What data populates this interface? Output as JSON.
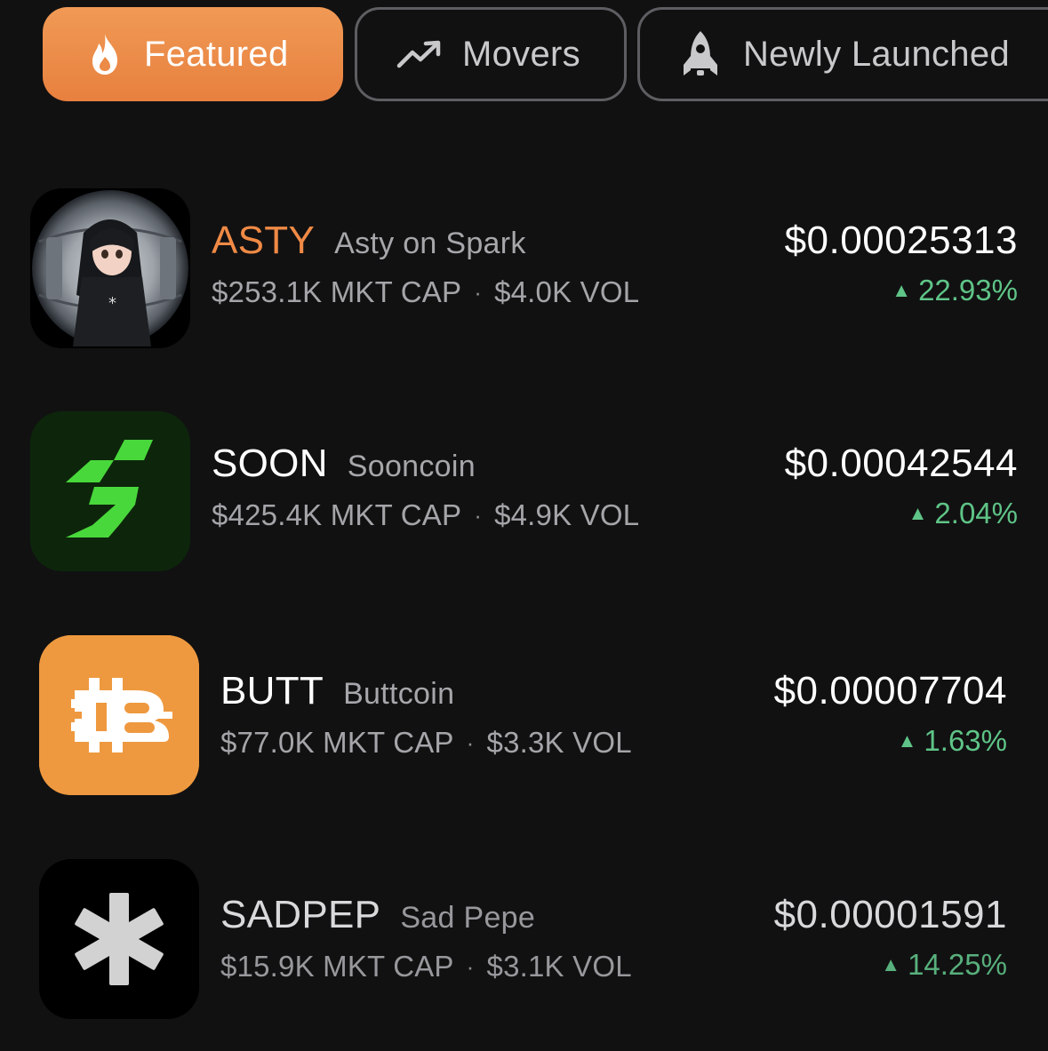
{
  "tabs": [
    {
      "label": "Featured",
      "icon": "fire-icon",
      "active": true
    },
    {
      "label": "Movers",
      "icon": "trending-up-icon",
      "active": false
    },
    {
      "label": "Newly Launched",
      "icon": "rocket-icon",
      "active": false
    }
  ],
  "colors": {
    "accent": "#ef8a45",
    "positive": "#5fc487",
    "background": "#111112"
  },
  "coins": [
    {
      "ticker": "ASTY",
      "name": "Asty on Spark",
      "mkt_cap": "$253.1K MKT CAP",
      "vol": "$4.0K VOL",
      "price": "$0.00025313",
      "change": "22.93%",
      "avatar": "anime-character-avatar"
    },
    {
      "ticker": "SOON",
      "name": "Sooncoin",
      "mkt_cap": "$425.4K MKT CAP",
      "vol": "$4.9K VOL",
      "price": "$0.00042544",
      "change": "2.04%",
      "avatar": "green-lightning-s-logo"
    },
    {
      "ticker": "BUTT",
      "name": "Buttcoin",
      "mkt_cap": "$77.0K MKT CAP",
      "vol": "$3.3K VOL",
      "price": "$0.00007704",
      "change": "1.63%",
      "avatar": "orange-butt-b-logo"
    },
    {
      "ticker": "SADPEP",
      "name": "Sad Pepe",
      "mkt_cap": "$15.9K MKT CAP",
      "vol": "$3.1K VOL",
      "price": "$0.00001591",
      "change": "14.25%",
      "avatar": "white-asterisk-logo"
    }
  ],
  "separator": "·",
  "up_arrow": "▲"
}
